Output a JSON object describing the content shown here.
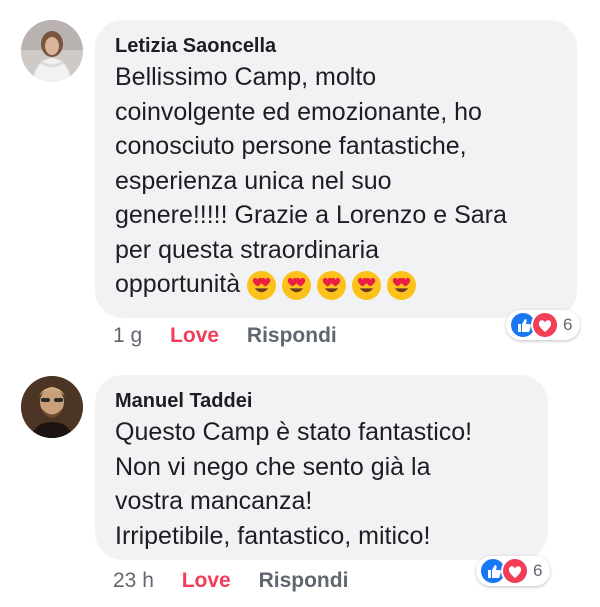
{
  "comments": [
    {
      "author": "Letizia Saoncella",
      "text_lines": [
        "Bellissimo Camp, molto",
        "coinvolgente ed emozionante, ho",
        "conosciuto persone fantastiche,",
        "esperienza unica nel suo",
        "genere!!!!! Grazie a Lorenzo e Sara",
        "per questa straordinaria",
        "opportunità"
      ],
      "emojis": [
        "heart-eyes-emoji",
        "heart-eyes-emoji",
        "heart-eyes-emoji",
        "heart-eyes-emoji",
        "heart-eyes-emoji"
      ],
      "time": "1 g",
      "love_label": "Love",
      "reply_label": "Rispondi",
      "reaction_count": "6",
      "reactions": [
        "like-icon",
        "love-icon"
      ]
    },
    {
      "author": "Manuel Taddei",
      "text_lines": [
        "Questo Camp è stato fantastico!",
        "Non vi nego che sento già la",
        "vostra mancanza!",
        "Irripetibile, fantastico, mitico!"
      ],
      "time": "23 h",
      "love_label": "Love",
      "reply_label": "Rispondi",
      "reaction_count": "6",
      "reactions": [
        "like-icon",
        "love-icon"
      ]
    }
  ],
  "colors": {
    "bubble": "#f1f2f4",
    "love": "#f33e58",
    "like": "#1877f2",
    "meta": "#606770"
  }
}
